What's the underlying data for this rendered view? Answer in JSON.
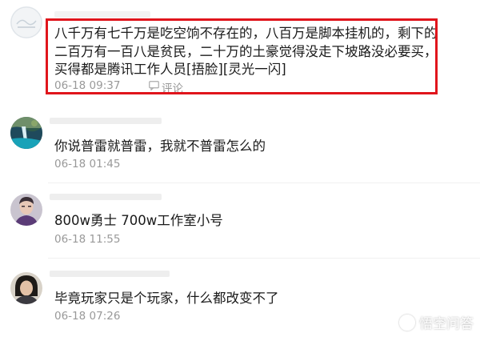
{
  "comments": [
    {
      "lines": [
        "八千万有七千万是吃空饷不存在的，八百万是脚本挂机的，剩下的",
        "二百万有一百八是贫民，二十万的土豪觉得没走下坡路没必要买，",
        "买得都是腾讯工作人员[捂脸][灵光一闪]"
      ],
      "date": "06-18 09:37",
      "reply_label": "评论",
      "avatar_icon": "faded-avatar-image"
    },
    {
      "lines": [
        "你说普雷就普雷，我就不普雷怎么的"
      ],
      "date": "06-18 01:45",
      "avatar_icon": "waterfall-landscape-avatar"
    },
    {
      "lines": [
        "800w勇士 700w工作室小号"
      ],
      "date": "06-18 11:55",
      "avatar_icon": "person-portrait-avatar"
    },
    {
      "lines": [
        "毕竟玩家只是个玩家，什么都改变不了"
      ],
      "date": "06-18 07:26",
      "avatar_icon": "dark-hair-portrait-avatar"
    }
  ],
  "watermark": {
    "text": "悟空问答",
    "logo_icon": "wukong-logo-icon"
  },
  "colors": {
    "highlight": "#e0151c",
    "meta_text": "#999999",
    "body_text": "#1a1a1a"
  }
}
